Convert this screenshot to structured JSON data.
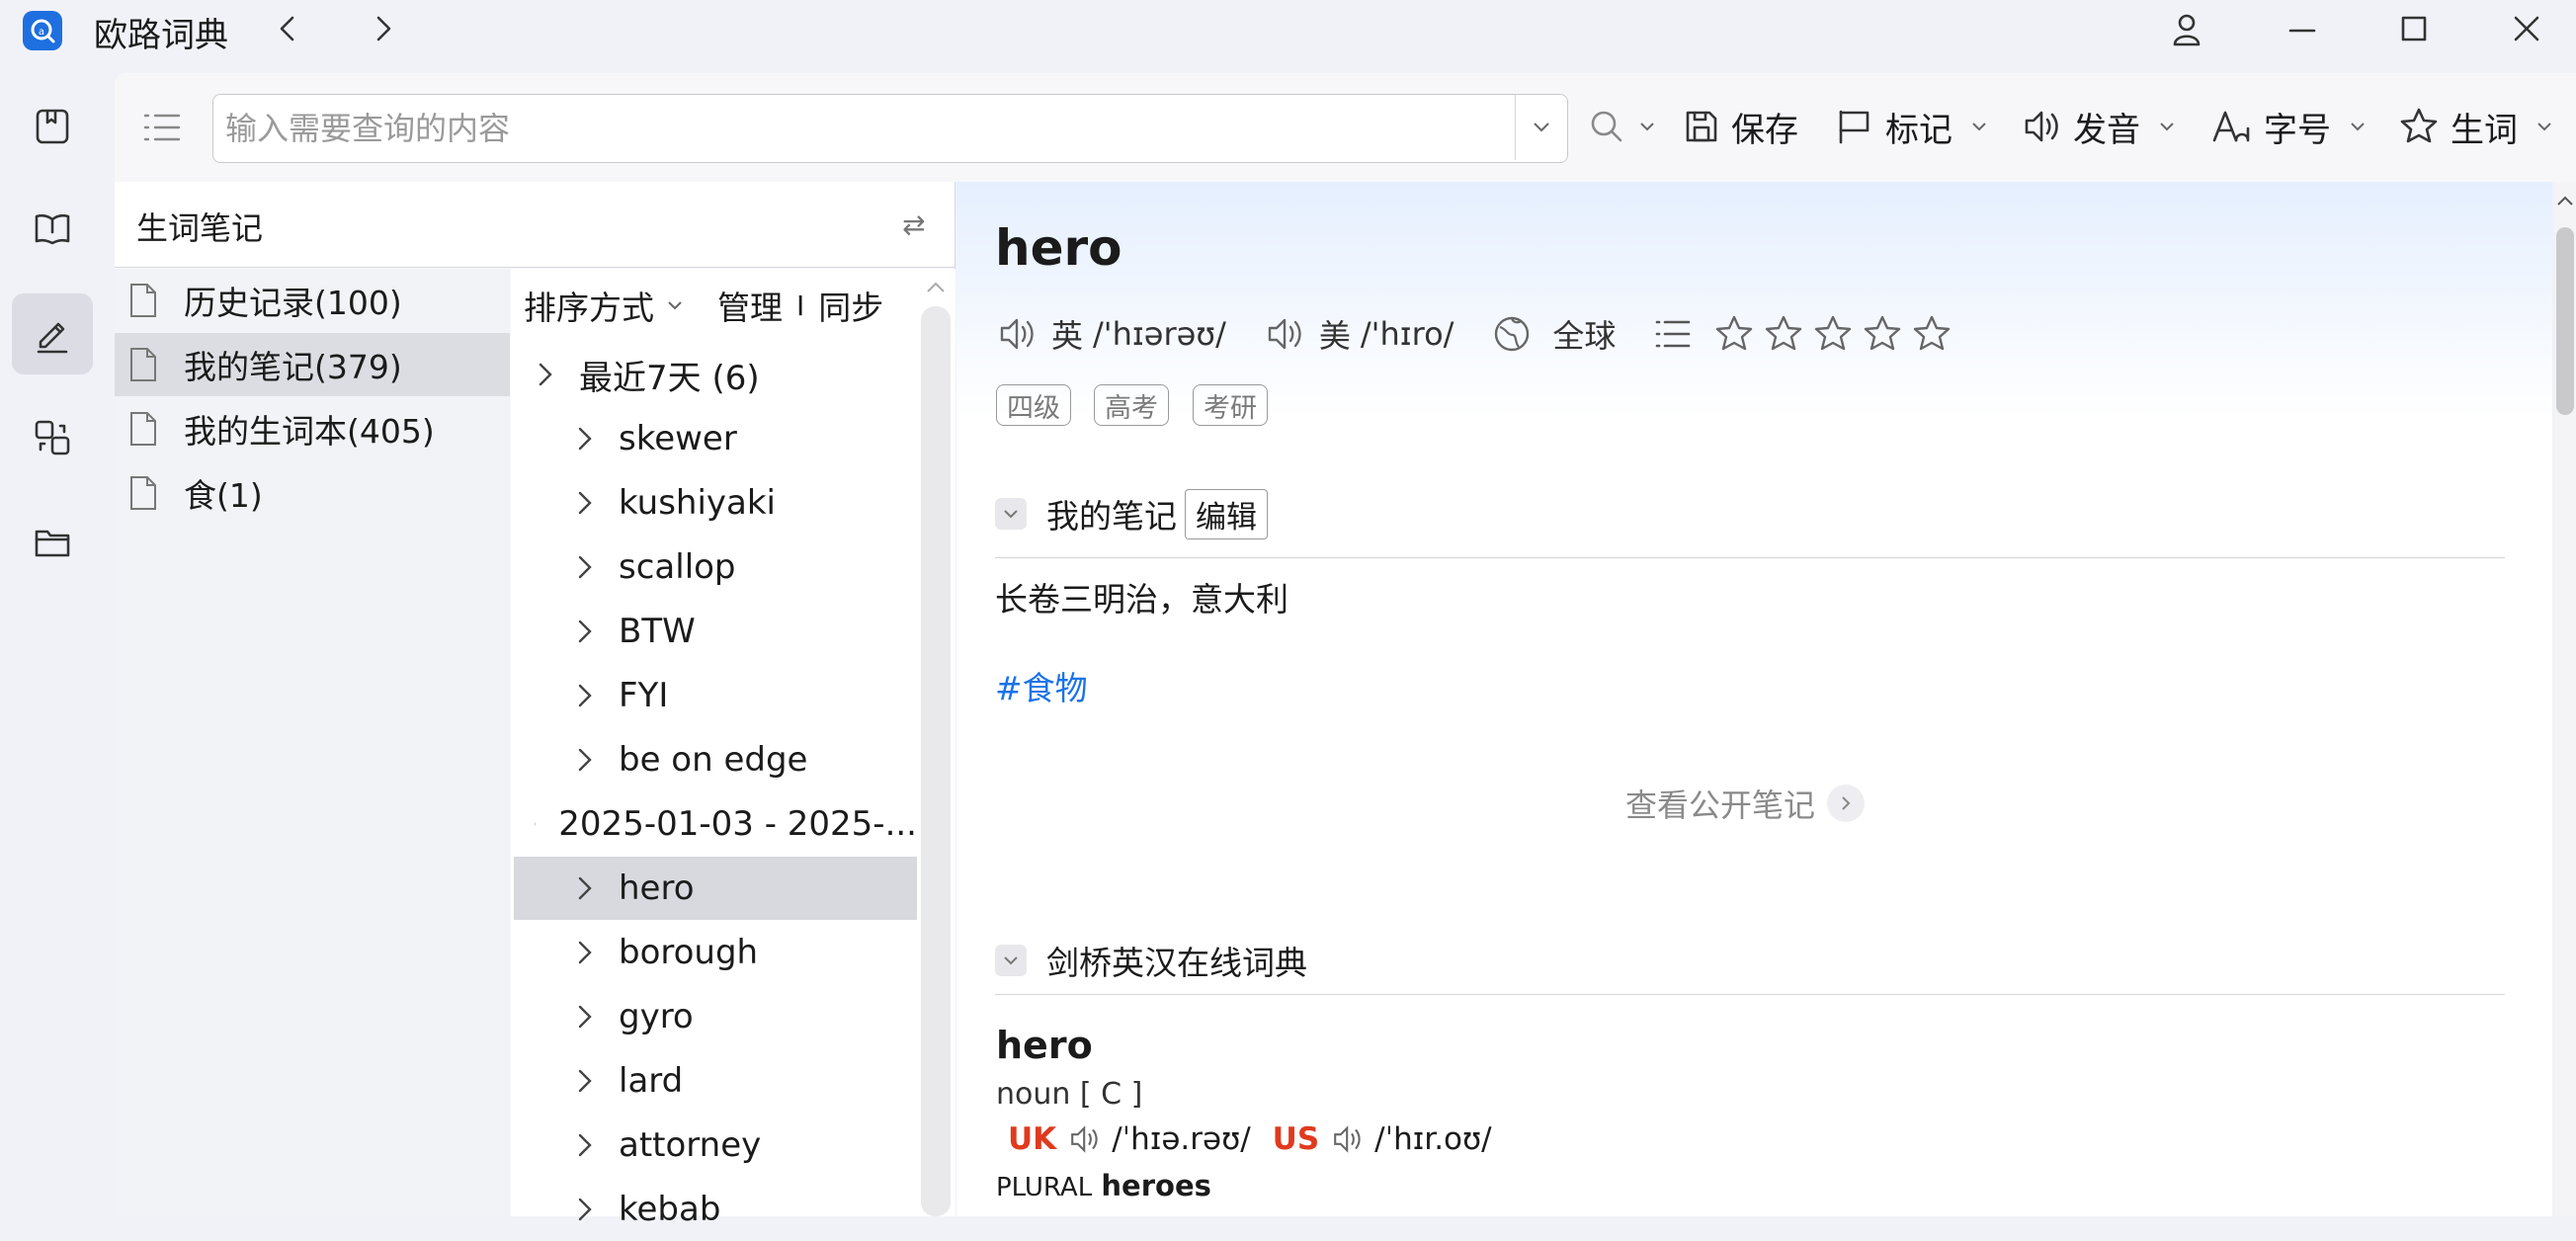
{
  "app": {
    "title": "欧路词典"
  },
  "toolbar": {
    "search_placeholder": "输入需要查询的内容",
    "save_label": "保存",
    "mark_label": "标记",
    "pronounce_label": "发音",
    "font_label": "字号",
    "wordbook_label": "生词"
  },
  "notebook": {
    "title": "生词笔记",
    "swap_icon": "⇄",
    "items": [
      {
        "label": "历史记录(100)"
      },
      {
        "label": "我的笔记(379)"
      },
      {
        "label": "我的生词本(405)"
      },
      {
        "label": "食(1)"
      }
    ],
    "selected_index": 1
  },
  "wordlist": {
    "sort_label": "排序方式",
    "manage_label": "管理",
    "divider": "I",
    "sync_label": "同步",
    "rows": [
      {
        "label": "最近7天  (6)",
        "level": 0
      },
      {
        "label": "skewer",
        "level": 1
      },
      {
        "label": "kushiyaki",
        "level": 1
      },
      {
        "label": "scallop",
        "level": 1
      },
      {
        "label": "BTW",
        "level": 1
      },
      {
        "label": "FYI",
        "level": 1
      },
      {
        "label": "be on edge",
        "level": 1
      },
      {
        "label": "2025-01-03 - 2025-...",
        "level": 0
      },
      {
        "label": "hero",
        "level": 1
      },
      {
        "label": "borough",
        "level": 1
      },
      {
        "label": "gyro",
        "level": 1
      },
      {
        "label": "lard",
        "level": 1
      },
      {
        "label": "attorney",
        "level": 1
      },
      {
        "label": "kebab",
        "level": 1
      }
    ],
    "selected_index": 8
  },
  "entry": {
    "headword": "hero",
    "uk_label": "英",
    "uk_phonetic": "/'hɪərəʊ/",
    "us_label": "美",
    "us_phonetic": "/'hɪro/",
    "global_label": "全球",
    "star_rating": 0,
    "star_max": 5,
    "tags": [
      "四级",
      "高考",
      "考研"
    ],
    "my_notes": {
      "title": "我的笔记",
      "edit_label": "编辑",
      "text": "长卷三明治，意大利",
      "tag": "#食物",
      "public_notes_label": "查看公开笔记"
    },
    "cambridge": {
      "title": "剑桥英汉在线词典",
      "word": "hero",
      "pos": "noun [ C ]",
      "uk_region": "UK",
      "uk_ipa": "/ˈhɪə.rəʊ/",
      "us_region": "US",
      "us_ipa": "/ˈhɪr.oʊ/",
      "plural_label": "PLURAL",
      "plural_word": "heroes"
    }
  },
  "colors": {
    "accent": "#1a73e8",
    "region": "#e03a1e",
    "app_icon": "#1e6fe0"
  }
}
